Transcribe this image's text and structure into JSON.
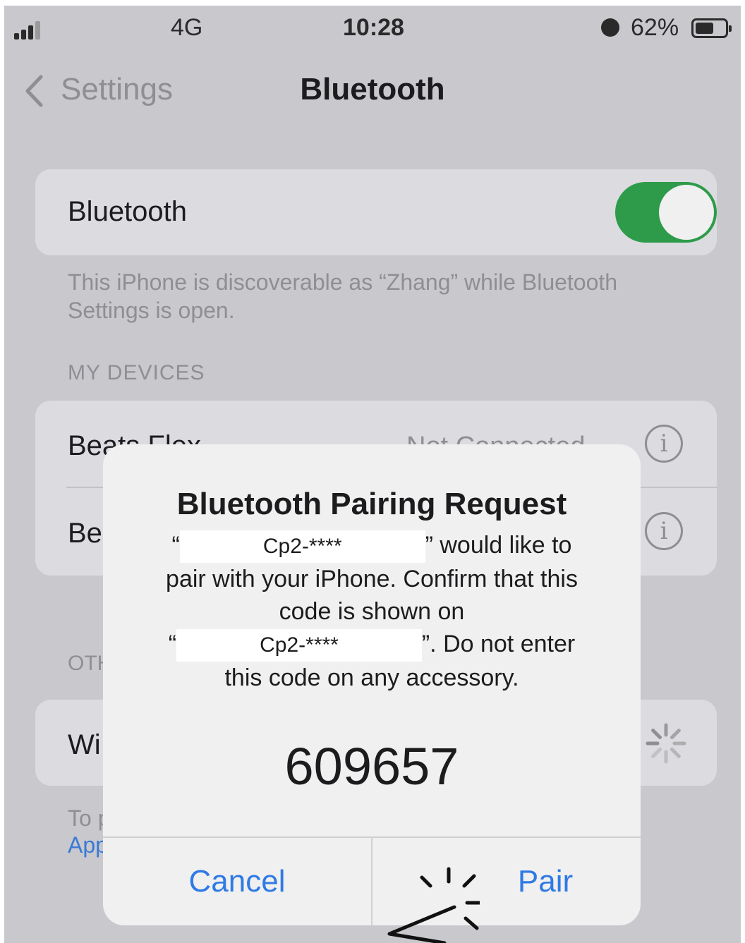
{
  "status_bar": {
    "network": "4G",
    "time": "10:28",
    "battery_percent": "62%",
    "battery_level": 0.62
  },
  "nav": {
    "back_label": "Settings",
    "title": "Bluetooth"
  },
  "bluetooth_toggle": {
    "label": "Bluetooth",
    "on": true,
    "color": "#2e9b4a"
  },
  "discoverable_note": "This iPhone is discoverable as “Zhang” while Bluetooth Settings is open.",
  "my_devices": {
    "header": "MY DEVICES",
    "items": [
      {
        "name": "Beats Flex",
        "status": "Not Connected"
      },
      {
        "name": "Be"
      }
    ]
  },
  "other_devices": {
    "header": "OTH",
    "items": [
      {
        "name": "Wi"
      }
    ],
    "footer_note": "To p",
    "footer_link": "App"
  },
  "dialog": {
    "title": "Bluetooth Pairing Request",
    "open_quote_1": "“",
    "device_name_1": "Cp2-****",
    "close_quote_1": "” would like to",
    "line2": "pair with your iPhone. Confirm that this",
    "line3": "code is shown on",
    "open_quote_2": "“",
    "device_name_2": "Cp2-****",
    "close_quote_2": "”. Do not enter",
    "line5": "this code on any accessory.",
    "code": "609657",
    "cancel_label": "Cancel",
    "pair_label": "Pair",
    "accent_color": "#2f7ae5"
  }
}
